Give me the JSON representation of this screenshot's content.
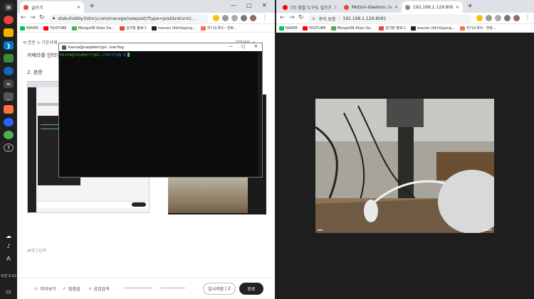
{
  "taskbar": {
    "time": "오전 3:22",
    "lang": "A",
    "icons": [
      "chrome-icon",
      "explorer-icon",
      "vscode-icon",
      "terminal-icon",
      "network-icon"
    ]
  },
  "left_window": {
    "tab": {
      "title": "글쓰기"
    },
    "address": "otakuhobby.tistory.com/manage/newpost/?type=post&returnU...",
    "bookmarks": [
      "NAVER",
      "YOUTUBE",
      "MongoDB Atlas Da...",
      "김지창 블로그",
      "kasnan (KimSajang...",
      "자기소개서 - 한화..."
    ],
    "editor": {
      "toolbar_left": "본문 ∨  기본서체",
      "toolbar_right": "기본모드 ∨",
      "line1": "카메라를 인터넷",
      "line2": "2. 본문",
      "tag_placeholder": "#태그입력",
      "bottom": {
        "preview": "미리보기",
        "spellcheck": "맞춤법",
        "search": "공감검색",
        "save": "임시저장",
        "save_count": "2",
        "done": "완료"
      }
    },
    "terminal": {
      "title": "kasna@raspberrypi: /var/log",
      "prompt_user": "kasna@raspberrypi",
      "prompt_path": ":/var/log $"
    }
  },
  "right_window": {
    "tabs": [
      "(7) 정말 누구도 알으르...",
      "Motion-daemon: /var/log/...",
      "192.168.1.129:8081"
    ],
    "address_warning": "주의 요함",
    "address": "192.168.1.129:8081",
    "bookmarks": [
      "NAVER",
      "YOUTUBE",
      "MongoDB Atlas Da...",
      "김지창 블로그",
      "kasnan (KimSajang...",
      "자기소개서 - 한화..."
    ]
  },
  "colors": {
    "taskbar": "#1f1f1f",
    "tab_strip": "#dee1e6",
    "terminal_bg": "#0c0c0c",
    "prompt_green": "#4ec94e",
    "prompt_blue": "#4a9fff",
    "done_button": "#222222"
  }
}
